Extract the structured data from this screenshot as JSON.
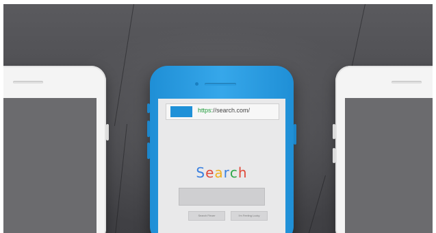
{
  "browser": {
    "url_scheme": "https:",
    "url_rest": "//search.com/"
  },
  "search_page": {
    "title_letters": [
      {
        "char": "S",
        "color": "#3a80e0"
      },
      {
        "char": "e",
        "color": "#e04a3a"
      },
      {
        "char": "a",
        "color": "#f0b020"
      },
      {
        "char": "r",
        "color": "#3a80e0"
      },
      {
        "char": "c",
        "color": "#2fa84a"
      },
      {
        "char": "h",
        "color": "#e04a3a"
      }
    ],
    "search_button_label": "Search Fleuer",
    "lucky_button_label": "I'm Feeling Lucky"
  },
  "colors": {
    "background": "#4b4b4f",
    "center_phone": "#2c9fe4",
    "side_phones": "#f4f4f4",
    "side_screens": "#6b6b6e",
    "url_tab": "#1f91d8"
  },
  "objects": [
    "left-white-phone",
    "center-blue-phone",
    "right-white-phone"
  ]
}
